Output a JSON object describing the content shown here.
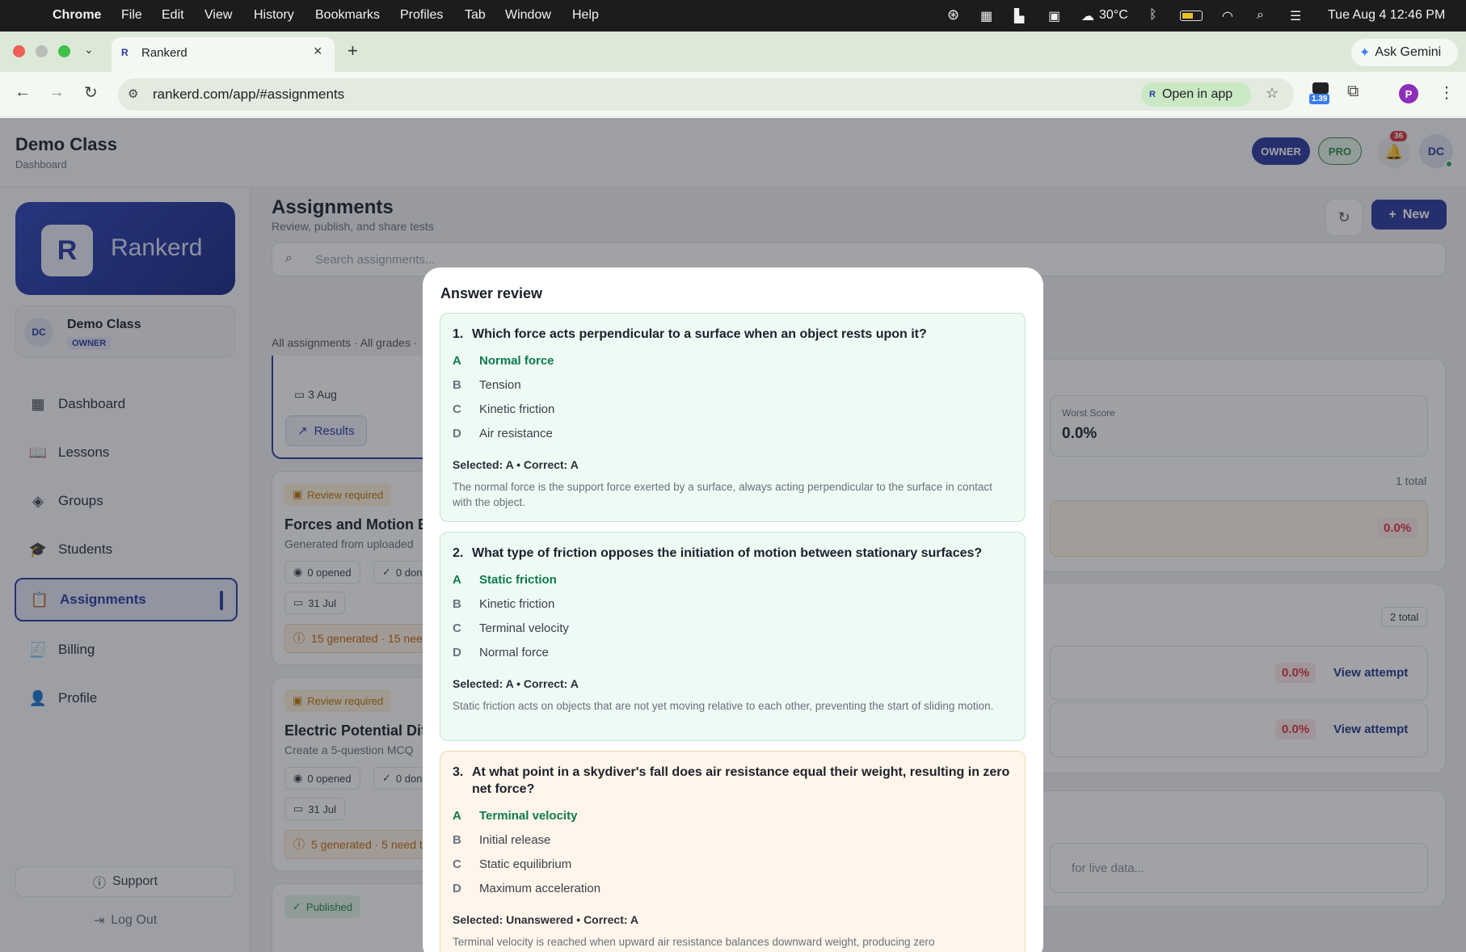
{
  "menubar": {
    "app": "Chrome",
    "items": [
      "File",
      "Edit",
      "View",
      "History",
      "Bookmarks",
      "Profiles",
      "Tab",
      "Window",
      "Help"
    ],
    "weather": "30°C",
    "datetime": "Tue Aug 4  12:46 PM"
  },
  "browser": {
    "tab_title": "Rankerd",
    "url": "rankerd.com/app/#assignments",
    "open_in_app": "Open in app",
    "ask_gemini": "Ask Gemini",
    "ext_badge": "1.39",
    "profile_initial": "P"
  },
  "header": {
    "class_name": "Demo Class",
    "subtitle": "Dashboard",
    "badge_owner": "OWNER",
    "badge_pro": "PRO",
    "notif_count": "36",
    "avatar": "DC"
  },
  "sidebar": {
    "brand": "Rankerd",
    "user_initials": "DC",
    "user_name": "Demo Class",
    "user_role": "OWNER",
    "items": [
      {
        "label": "Dashboard",
        "icon": "grid-icon"
      },
      {
        "label": "Lessons",
        "icon": "book-icon"
      },
      {
        "label": "Groups",
        "icon": "layers-icon"
      },
      {
        "label": "Students",
        "icon": "graduation-cap-icon"
      },
      {
        "label": "Assignments",
        "icon": "clipboard-icon"
      },
      {
        "label": "Billing",
        "icon": "receipt-icon"
      },
      {
        "label": "Profile",
        "icon": "user-icon"
      }
    ],
    "support": "Support",
    "logout": "Log Out"
  },
  "main": {
    "title": "Assignments",
    "subtitle": "Review, publish, and share tests",
    "new_button": "New",
    "search_placeholder": "Search assignments...",
    "filter_text": "All assignments · All grades ·",
    "card0": {
      "date": "3 Aug",
      "results": "Results"
    },
    "card1": {
      "badge": "Review required",
      "title": "Forces and Motion Ba",
      "desc": "Generated from uploaded",
      "opened": "0 opened",
      "done": "0 don",
      "date": "31 Jul",
      "warning": "15 generated · 15 nee"
    },
    "card2": {
      "badge": "Review required",
      "title": "Electric Potential Diffe",
      "desc": "Create a 5-question MCQ",
      "opened": "0 opened",
      "done": "0 don",
      "date": "31 Jul",
      "warning": "5 generated · 5 need t"
    },
    "card3": {
      "badge": "Published"
    }
  },
  "right_panel": {
    "worst_score_label": "Worst Score",
    "worst_score_value": "0.0%",
    "total1": "1 total",
    "score1": "0.0%",
    "total2": "2 total",
    "attempts": [
      {
        "score": "0.0%",
        "action": "View attempt"
      },
      {
        "score": "0.0%",
        "action": "View attempt"
      }
    ],
    "live_placeholder": "for live data..."
  },
  "modal": {
    "title": "Answer review",
    "questions": [
      {
        "num": "1.",
        "text": "Which force acts perpendicular to a surface when an object rests upon it?",
        "options": [
          {
            "letter": "A",
            "text": "Normal force"
          },
          {
            "letter": "B",
            "text": "Tension"
          },
          {
            "letter": "C",
            "text": "Kinetic friction"
          },
          {
            "letter": "D",
            "text": "Air resistance"
          }
        ],
        "selection": "Selected: A  •  Correct: A",
        "explanation": "The normal force is the support force exerted by a surface, always acting perpendicular to the surface in contact with the object."
      },
      {
        "num": "2.",
        "text": "What type of friction opposes the initiation of motion between stationary surfaces?",
        "options": [
          {
            "letter": "A",
            "text": "Static friction"
          },
          {
            "letter": "B",
            "text": "Kinetic friction"
          },
          {
            "letter": "C",
            "text": "Terminal velocity"
          },
          {
            "letter": "D",
            "text": "Normal force"
          }
        ],
        "selection": "Selected: A  •  Correct: A",
        "explanation": "Static friction acts on objects that are not yet moving relative to each other, preventing the start of sliding motion."
      },
      {
        "num": "3.",
        "text": "At what point in a skydiver's fall does air resistance equal their weight, resulting in zero net force?",
        "options": [
          {
            "letter": "A",
            "text": "Terminal velocity"
          },
          {
            "letter": "B",
            "text": "Initial release"
          },
          {
            "letter": "C",
            "text": "Static equilibrium"
          },
          {
            "letter": "D",
            "text": "Maximum acceleration"
          }
        ],
        "selection": "Selected: Unanswered  •  Correct: A",
        "explanation": "Terminal velocity is reached when upward air resistance balances downward weight, producing zero"
      }
    ]
  },
  "colors": {
    "brand": "#2b3a9f",
    "correct": "#0f7a52",
    "danger": "#d9363e"
  }
}
